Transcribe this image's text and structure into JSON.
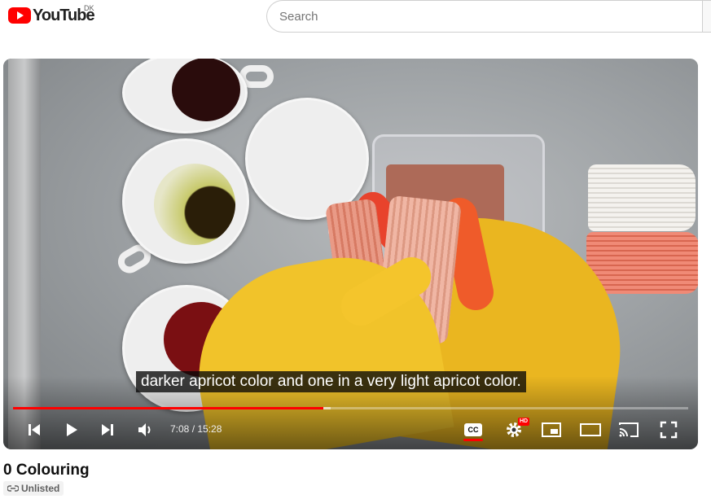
{
  "header": {
    "logo_text": "YouTube",
    "region": "DK",
    "search_placeholder": "Search"
  },
  "player": {
    "caption": "darker apricot color and one in a very light apricot color.",
    "time_current": "7:08",
    "time_separator": " / ",
    "time_total": "15:28",
    "progress_fraction": 0.46,
    "buffered_fraction": 0.47,
    "hd_label": "HD",
    "cc_label": "CC",
    "captions_on": true
  },
  "video": {
    "title": "0 Colouring",
    "visibility": "Unlisted"
  },
  "colors": {
    "brand_red": "#ff0000"
  }
}
